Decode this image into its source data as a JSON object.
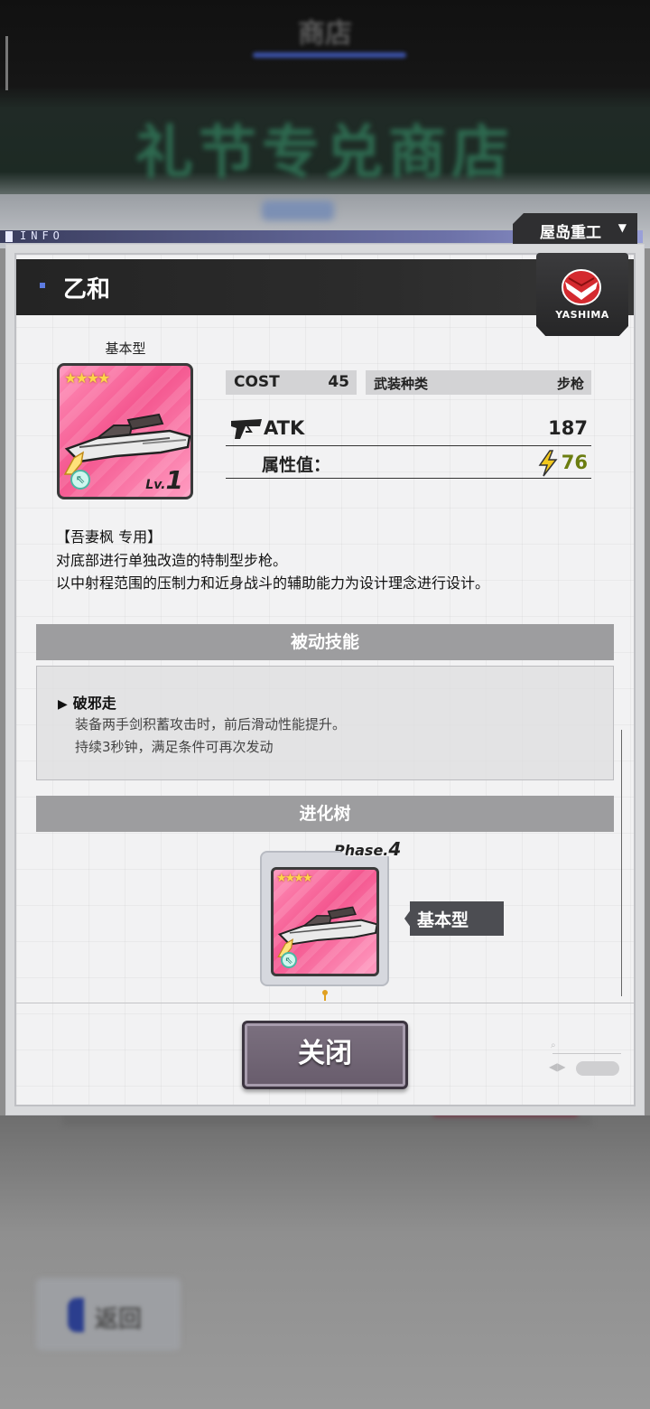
{
  "background": {
    "top_title": "商店",
    "banner_text": "礼节专兑商店",
    "back_button_label": "返回"
  },
  "info_strip": {
    "label": "INFO"
  },
  "manufacturer": {
    "name": "屋岛重工",
    "dropdown_icon": "triangle-down-icon",
    "logo_text": "YASHIMA"
  },
  "item": {
    "name": "乙和",
    "type_label": "基本型",
    "stars": "★★★★",
    "level_prefix": "Lv.",
    "level": "1",
    "rarity_icon": "arrow-badge-icon",
    "cost_label": "COST",
    "cost_value": "45",
    "weapon_type_label": "武装种类",
    "weapon_type_value": "步枪",
    "atk_label": "ATK",
    "atk_value": "187",
    "attribute_label": "属性值：",
    "attribute_value": "76",
    "attribute_color": "#6b7d10"
  },
  "description": {
    "line1": "【吾妻枫 专用】",
    "line2": "对底部进行单独改造的特制型步枪。",
    "line3": "以中射程范围的压制力和近身战斗的辅助能力为设计理念进行设计。"
  },
  "passive": {
    "header": "被动技能",
    "skill_name": "破邪走",
    "skill_desc_1": "装备两手剑积蓄攻击时，前后滑动性能提升。",
    "skill_desc_2": "持续3秒钟，满足条件可再次发动"
  },
  "evolution": {
    "header": "进化树",
    "phase_prefix": "Phase.",
    "phase_number": "4",
    "stars": "★★★★",
    "node_label": "基本型"
  },
  "footer": {
    "close_label": "关闭"
  },
  "colors": {
    "card_pink": "#f4568f",
    "title_bar": "#242424",
    "section_header": "#9d9d9f",
    "close_button": "#6f6374"
  }
}
